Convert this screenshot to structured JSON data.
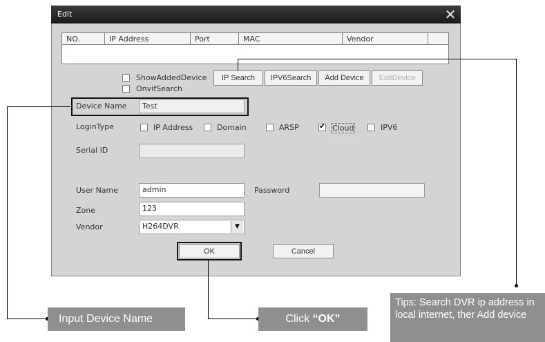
{
  "dialog": {
    "title": "Edit",
    "close_icon": "close-icon"
  },
  "device_table": {
    "columns": [
      "NO.",
      "IP Address",
      "Port",
      "MAC",
      "Vendor"
    ]
  },
  "options": {
    "show_added_device": "ShowAddedDevice",
    "onvif_search": "OnvifSearch"
  },
  "buttons": {
    "ip_search": "IP Search",
    "ipv6_search": "IPV6Search",
    "add_device": "Add Device",
    "edit_device": "EditDevice",
    "ok": "OK",
    "cancel": "Cancel"
  },
  "form": {
    "device_name_label": "Device Name",
    "device_name_value": "Test",
    "login_type_label": "LoginType",
    "login_types": [
      {
        "label": "IP Address",
        "checked": false
      },
      {
        "label": "Domain",
        "checked": false
      },
      {
        "label": "ARSP",
        "checked": false
      },
      {
        "label": "Cloud",
        "checked": true
      },
      {
        "label": "IPV6",
        "checked": false
      }
    ],
    "serial_id_label": "Serial ID",
    "serial_id_value": "",
    "user_name_label": "User Name",
    "user_name_value": "admin",
    "password_label": "Password",
    "password_value": "",
    "zone_label": "Zone",
    "zone_value": "123",
    "vendor_label": "Vendor",
    "vendor_value": "H264DVR"
  },
  "callouts": {
    "input_device_name": "Input Device Name",
    "click_prefix": "Click ",
    "click_ok": "“OK”",
    "tips": "Tips: Search DVR ip address in local internet, ther Add device"
  },
  "colors": {
    "titlebar": "#2a2a2a",
    "dialog_bg": "#d4d4d4",
    "callout_bg": "#8f8f8f"
  }
}
